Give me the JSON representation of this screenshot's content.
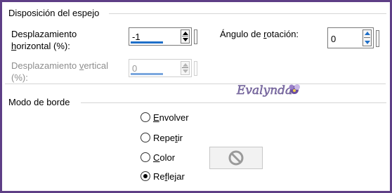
{
  "mirror_group": {
    "title": "Disposición del espejo",
    "h_offset": {
      "label_line1": "Desplazamiento",
      "label_line2_pre": "",
      "label_line2_u": "h",
      "label_line2_post": "orizontal (%):",
      "value": "-1"
    },
    "v_offset": {
      "label_line1_pre": "Desplazamiento ",
      "label_line1_u": "v",
      "label_line1_post": "ertical",
      "label_line2": "(%):",
      "value": "0"
    },
    "rotation": {
      "label_pre": "Ángulo de ",
      "label_u": "r",
      "label_post": "otación:",
      "value": "0"
    }
  },
  "watermark": {
    "text": "Evalynda"
  },
  "border_group": {
    "title": "Modo de borde",
    "options": [
      {
        "u": "E",
        "rest": "nvolver",
        "pre": "",
        "checked": false
      },
      {
        "pre": "Repe",
        "u": "t",
        "rest": "ir",
        "checked": false
      },
      {
        "pre": "",
        "u": "C",
        "rest": "olor",
        "checked": false
      },
      {
        "pre": "Re",
        "u": "f",
        "rest": "lejar",
        "checked": true
      }
    ]
  },
  "colors": {
    "frame": "#5e3f86",
    "accent_blue": "#1e6fc8"
  }
}
